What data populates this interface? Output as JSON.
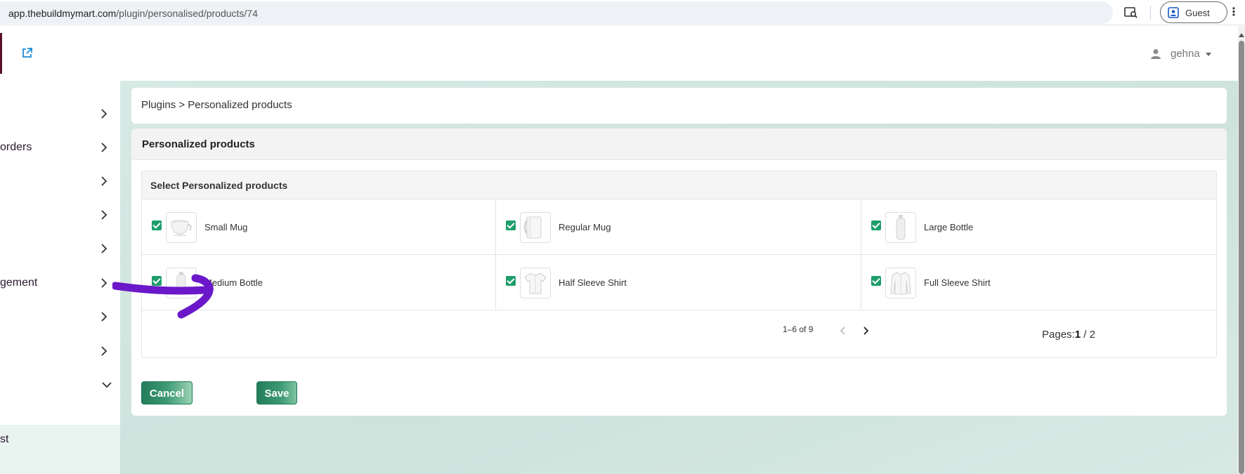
{
  "browser": {
    "url_domain": "app.thebuildmymart.com",
    "url_path": "/plugin/personalised/products/74",
    "profile_label": "Guest",
    "menu_glyph": "⋮"
  },
  "header": {
    "user_name": "gehna"
  },
  "sidebar": {
    "items": [
      {
        "label": ""
      },
      {
        "label": "orders"
      },
      {
        "label": ""
      },
      {
        "label": ""
      },
      {
        "label": ""
      },
      {
        "label": "gement"
      },
      {
        "label": ""
      },
      {
        "label": ""
      },
      {
        "label": ""
      }
    ],
    "sub_item": "st"
  },
  "breadcrumb": {
    "text": "Plugins > Personalized products"
  },
  "panel": {
    "title": "Personalized products",
    "section_title": "Select Personalized products"
  },
  "products": [
    {
      "name": "Small Mug",
      "checked": true,
      "icon": "mug-small-icon"
    },
    {
      "name": "Regular Mug",
      "checked": true,
      "icon": "mug-regular-icon"
    },
    {
      "name": "Large Bottle",
      "checked": true,
      "icon": "bottle-large-icon"
    },
    {
      "name": "Medium Bottle",
      "checked": true,
      "icon": "bottle-medium-icon"
    },
    {
      "name": "Half Sleeve Shirt",
      "checked": true,
      "icon": "shirt-half-icon"
    },
    {
      "name": "Full Sleeve Shirt",
      "checked": true,
      "icon": "shirt-full-icon"
    }
  ],
  "pagination": {
    "range": "1–6 of 9",
    "pages_label": "Pages:",
    "current_page": "1",
    "separator": " / ",
    "total_pages": "2"
  },
  "actions": {
    "cancel_label": "Cancel",
    "save_label": "Save"
  },
  "colors": {
    "accent": "#1e9e6a",
    "annotation": "#6a18c9",
    "brand": "#5a1025"
  }
}
